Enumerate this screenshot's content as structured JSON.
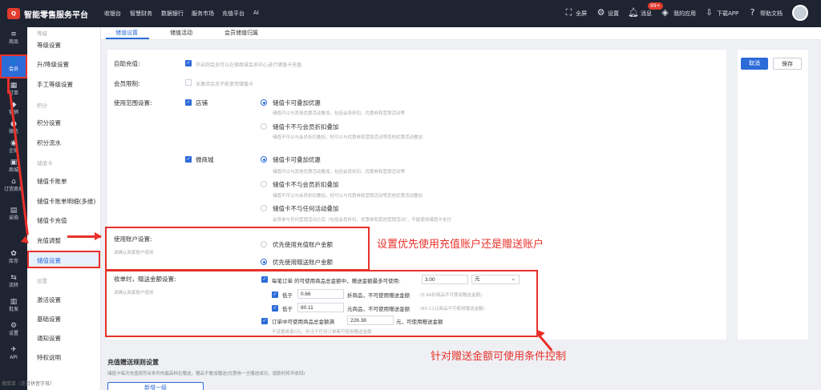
{
  "topbar": {
    "logo": "Q",
    "title": "智能零售服务平台",
    "nav": [
      "收银台",
      "智慧财务",
      "数据银行",
      "服务市场",
      "充值平台",
      "AI"
    ],
    "fullscreen": "全屏",
    "settings": "设置",
    "messages": "消息",
    "messages_badge": "99+",
    "my_apps": "我的应用",
    "download_app": "下载APP",
    "help": "帮助文档"
  },
  "rail": {
    "items": [
      {
        "label": "商品",
        "icon": "≡"
      },
      {
        "label": "会员",
        "icon": "👤"
      },
      {
        "label": "订单",
        "icon": "▦"
      },
      {
        "label": "营销",
        "icon": "◆"
      },
      {
        "label": "微信",
        "icon": "●"
      },
      {
        "label": "企微",
        "icon": "◉"
      },
      {
        "label": "商城",
        "icon": "▣"
      },
      {
        "label": "订货商城",
        "icon": "⌂"
      },
      {
        "label": "采购",
        "icon": "▤"
      },
      {
        "label": "库存",
        "icon": "✿"
      },
      {
        "label": "流转",
        "icon": "⇆"
      },
      {
        "label": "批发",
        "icon": "▥"
      },
      {
        "label": "设置",
        "icon": "⚙"
      },
      {
        "label": "API",
        "icon": "✈"
      }
    ]
  },
  "submenu": {
    "top_header": "等级",
    "items_level": [
      "等级设置",
      "升/降级设置",
      "手工等级设置"
    ],
    "points_header": "积分",
    "items_points": [
      "积分设置",
      "积分流水"
    ],
    "stored_header": "储值卡",
    "items_stored": [
      "储值卡账单",
      "储值卡账单明细(多维)",
      "储值卡充值",
      "充值调整",
      "储值设置"
    ],
    "settings_header": "设置",
    "items_settings": [
      "激活设置",
      "基础设置",
      "通知设置",
      "特权说明"
    ],
    "search_placeholder": "搜菜单（支持拼音字母）"
  },
  "tabs": [
    "储值设置",
    "储值活动",
    "会员储值归属"
  ],
  "actions": {
    "cancel": "取消",
    "save": "保存"
  },
  "auto_recharge": {
    "label": "自助充值:",
    "option": "开启则会员可以在微商城会员中心进行储值卡充值"
  },
  "member_limit": {
    "label": "会员限制:",
    "option": "未激活会员不能使用储值卡"
  },
  "scope": {
    "label": "使用范围设置:",
    "store": "店铺",
    "mall": "微商城",
    "store_options": [
      {
        "title": "储值卡可叠加优惠",
        "desc": "储值可以与其他优惠活动叠加，包括会员折扣、优惠券和营销活动等"
      },
      {
        "title": "储值卡不与会员折扣叠加",
        "desc": "储值不可以与会员折扣叠加，但可以与优惠券和营销活动等其他优惠活动叠加"
      }
    ],
    "mall_options": [
      {
        "title": "储值卡可叠加优惠",
        "desc": "储值可以与其他优惠活动叠加，包括会员折扣、优惠券和营销活动等"
      },
      {
        "title": "储值卡不与会员折扣叠加",
        "desc": "储值不可以与会员折扣叠加，但可以与优惠券和营销活动等其他优惠活动叠加"
      },
      {
        "title": "储值卡不与任何活动叠加",
        "desc": "会员参与任何营销活动之后（包括会员折扣、优惠券和其他营销活动），不能使用储值卡支付"
      }
    ]
  },
  "account": {
    "label": "使用账户设置:",
    "hint": "请确认商家账户使用",
    "opt_recharge": "优先使用充值账户金额",
    "opt_gift": "优先使用赠送账户金额"
  },
  "gift": {
    "label": "收单时，赠送金额设置:",
    "hint": "请确认商家账户使用",
    "row1_text": "每笔订单 的可使用商品总金额中，赠送金额最多可使用:",
    "row1_value": "3.00",
    "row1_unit": "元",
    "row2_prefix": "低于",
    "row2_value": "0.66",
    "row2_suffix": "折商品，不可使用赠送金额",
    "row2_hint": "(0.66折商品不可使用赠送金额)",
    "row3_prefix": "低于",
    "row3_value": "80.11",
    "row3_suffix": "元商品，不可使用赠送金额",
    "row3_hint": "(80.11元商品不可使用赠送金额)",
    "row4_text": "订单中可使用商品总金额满",
    "row4_value": "226.38",
    "row4_suffix": "元，可使用赠送金额",
    "row4_hint": "不设置或者0元，则当于任何订单都可使用赠送金额"
  },
  "annotations": {
    "account": "设置优先使用充值账户还是赠送账户",
    "gift": "针对赠送金额可使用条件控制"
  },
  "bottom": {
    "title": "充值赠送规则设置",
    "hint": "储值卡每次充值按符合条件的最高档位赠送，赠品不叠加赠送(优惠券一旦赠送成功，退款时将不收回)",
    "add_button": "新增一级"
  },
  "colors": {
    "accent": "#2d6bd8",
    "annotation": "#e8312a",
    "topbar": "#1f2433"
  }
}
